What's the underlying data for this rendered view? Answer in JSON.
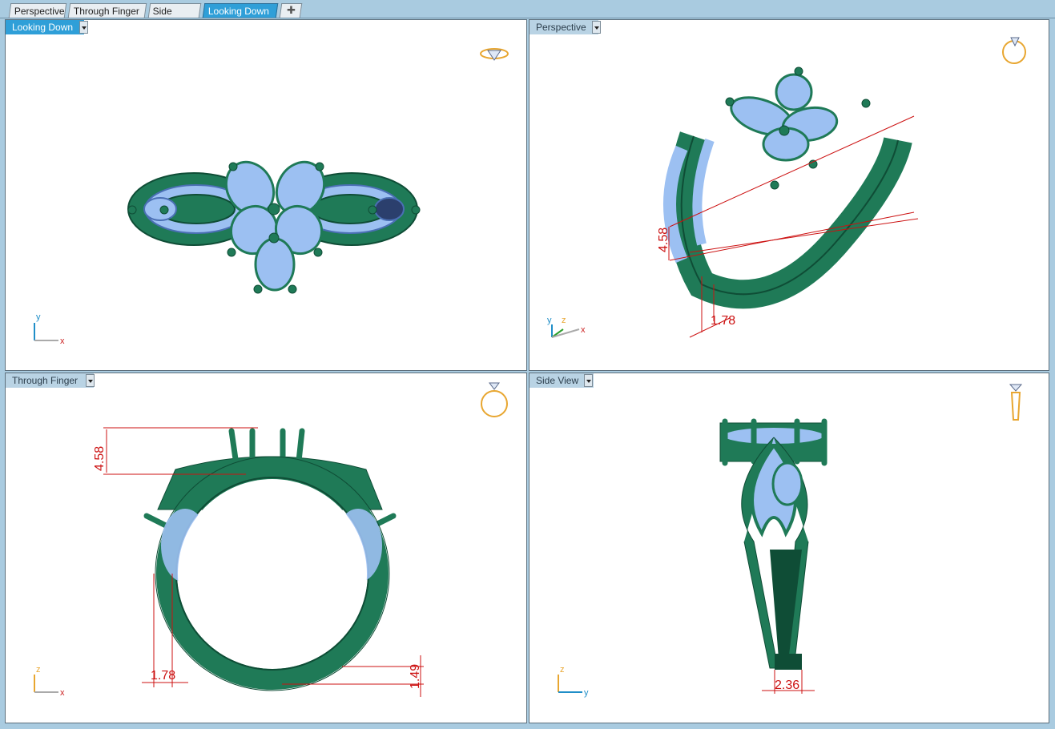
{
  "tabs": [
    {
      "label": "Perspective",
      "active": false
    },
    {
      "label": "Through Finger",
      "active": false
    },
    {
      "label": "Side View",
      "active": false
    },
    {
      "label": "Looking Down",
      "active": true
    }
  ],
  "add_tab_icon": "plus-icon",
  "viewports": {
    "top_left": {
      "title": "Looking Down",
      "active": true,
      "axis": {
        "vertical": "y",
        "horizontal": "x"
      }
    },
    "top_right": {
      "title": "Perspective",
      "active": false,
      "axis": {
        "vertical": "y",
        "vertical2": "z",
        "horizontal": "x"
      }
    },
    "bottom_left": {
      "title": "Through Finger",
      "active": false,
      "axis": {
        "vertical": "z",
        "horizontal": "x"
      },
      "dimensions": {
        "top_height": "4.58",
        "band_width": "1.78",
        "bottom_thickness": "1.49"
      }
    },
    "bottom_right": {
      "title": "Side View",
      "active": false,
      "axis": {
        "vertical": "z",
        "horizontal": "y"
      },
      "dimensions": {
        "shank_width": "2.36"
      }
    }
  },
  "perspective_dimensions": {
    "height": "4.58",
    "width": "1.78"
  },
  "colors": {
    "metal": "#1f7a57",
    "metal_dark": "#0f4d36",
    "stone": "#9cc0f2",
    "stone_edge": "#4a6fb4",
    "dimension": "#cc1111",
    "gizmo": "#e8a630"
  }
}
